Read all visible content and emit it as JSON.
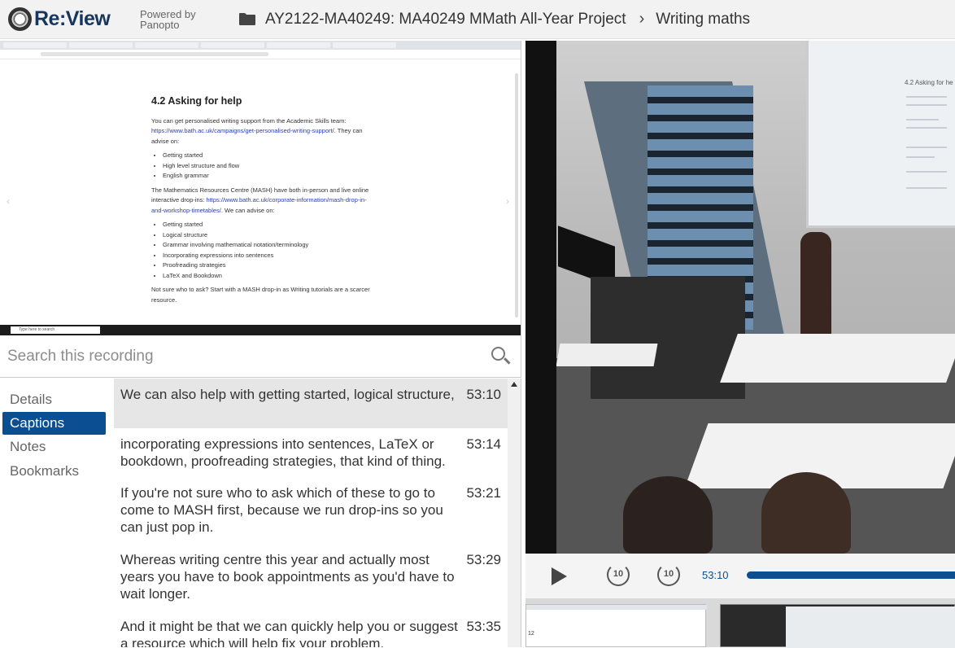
{
  "header": {
    "logo_text": "Re:View",
    "powered_by": "Powered by",
    "powered_brand": "Panopto",
    "folder_name": "AY2122-MA40249: MA40249 MMath All-Year Project",
    "session_title": "Writing maths"
  },
  "slide": {
    "heading": "4.2  Asking for help",
    "p1_a": "You can get personalised writing support from the Academic Skills team: ",
    "p1_link": "https://www.bath.ac.uk/campaigns/get-personalised-writing-support/",
    "p1_b": ". They can advise on:",
    "list1": [
      "Getting started",
      "High level structure and flow",
      "English grammar"
    ],
    "p2_a": "The Mathematics Resources Centre (MASH) have both in-person and live online interactive drop-ins: ",
    "p2_link": "https://www.bath.ac.uk/corporate-information/mash-drop-in-and-workshop-timetables/",
    "p2_b": ". We can advise on:",
    "list2": [
      "Getting started",
      "Logical structure",
      "Grammar involving mathematical notation/terminology",
      "Incorporating expressions into sentences",
      "Proofreading strategies",
      "LaTeX and Bookdown"
    ],
    "p3": "Not sure who to ask? Start with a MASH drop-in as Writing tutorials are a scarcer resource.",
    "taskbar_search": "Type here to search"
  },
  "search": {
    "placeholder": "Search this recording",
    "value": ""
  },
  "sidetabs": [
    {
      "label": "Details",
      "active": false
    },
    {
      "label": "Captions",
      "active": true
    },
    {
      "label": "Notes",
      "active": false
    },
    {
      "label": "Bookmarks",
      "active": false
    }
  ],
  "captions": [
    {
      "text": "We can also help with getting started, logical structure,",
      "time": "53:10",
      "active": true
    },
    {
      "text": "incorporating expressions into sentences, LaTeX or bookdown, proofreading strategies, that kind of thing.",
      "time": "53:14",
      "active": false
    },
    {
      "text": "If you're not sure who to ask which of these to go to come to MASH first, because we run drop-ins so you can just pop in.",
      "time": "53:21",
      "active": false
    },
    {
      "text": "Whereas writing centre this year and actually most years you have to book appointments as you'd have to wait longer.",
      "time": "53:29",
      "active": false
    },
    {
      "text": "And it might be that we can quickly help you or suggest a resource which will help fix your problem.",
      "time": "53:35",
      "active": false
    }
  ],
  "video": {
    "slide_title": "4.2  Asking for he"
  },
  "controls": {
    "skip_back_label": "10",
    "skip_forward_label": "10",
    "current_time": "53:10"
  },
  "thumbnails": {
    "thumb1_number": "12"
  },
  "colors": {
    "accent": "#0b4f92",
    "brand": "#17365d",
    "active_caption_bg": "#e6e6e6"
  }
}
